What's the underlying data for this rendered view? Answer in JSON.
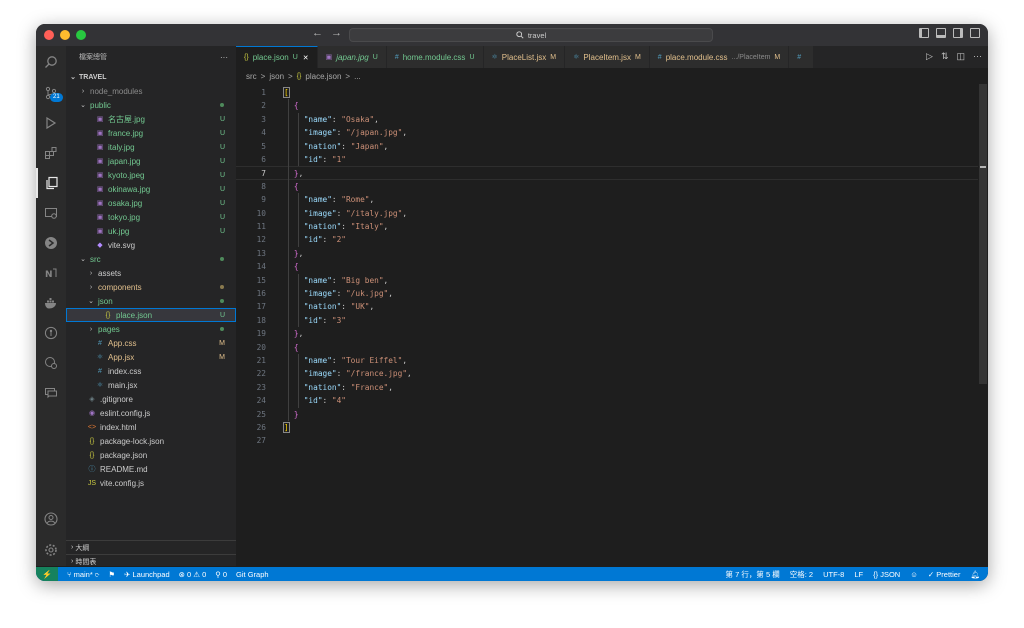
{
  "titlebar": {
    "search_text": "travel",
    "back": "←",
    "forward": "→"
  },
  "activity": {
    "scm_badge": "21"
  },
  "sidebar": {
    "header": "檔案總管",
    "more": "···",
    "root": "TRAVEL",
    "items": [
      {
        "name": "node_modules",
        "type": "folder",
        "open": false,
        "depth": 1,
        "status": "",
        "color": "grey"
      },
      {
        "name": "public",
        "type": "folder",
        "open": true,
        "depth": 1,
        "status": "dot",
        "color": "green"
      },
      {
        "name": "名古屋.jpg",
        "type": "image",
        "depth": 2,
        "status": "U",
        "color": "green"
      },
      {
        "name": "france.jpg",
        "type": "image",
        "depth": 2,
        "status": "U",
        "color": "green"
      },
      {
        "name": "italy.jpg",
        "type": "image",
        "depth": 2,
        "status": "U",
        "color": "green"
      },
      {
        "name": "japan.jpg",
        "type": "image",
        "depth": 2,
        "status": "U",
        "color": "green"
      },
      {
        "name": "kyoto.jpeg",
        "type": "image",
        "depth": 2,
        "status": "U",
        "color": "green"
      },
      {
        "name": "okinawa.jpg",
        "type": "image",
        "depth": 2,
        "status": "U",
        "color": "green"
      },
      {
        "name": "osaka.jpg",
        "type": "image",
        "depth": 2,
        "status": "U",
        "color": "green"
      },
      {
        "name": "tokyo.jpg",
        "type": "image",
        "depth": 2,
        "status": "U",
        "color": "green"
      },
      {
        "name": "uk.jpg",
        "type": "image",
        "depth": 2,
        "status": "U",
        "color": "green"
      },
      {
        "name": "vite.svg",
        "type": "svg",
        "depth": 2,
        "status": "",
        "color": "plain"
      },
      {
        "name": "src",
        "type": "folder",
        "open": true,
        "depth": 1,
        "status": "dot",
        "color": "green"
      },
      {
        "name": "assets",
        "type": "folder",
        "open": false,
        "depth": 2,
        "status": "",
        "color": "plain"
      },
      {
        "name": "components",
        "type": "folder",
        "open": false,
        "depth": 2,
        "status": "dot",
        "color": "orange"
      },
      {
        "name": "json",
        "type": "folder",
        "open": true,
        "depth": 2,
        "status": "dot",
        "color": "green"
      },
      {
        "name": "place.json",
        "type": "json",
        "depth": 3,
        "status": "U",
        "color": "green",
        "selected": true
      },
      {
        "name": "pages",
        "type": "folder",
        "open": false,
        "depth": 2,
        "status": "dot",
        "color": "green"
      },
      {
        "name": "App.css",
        "type": "css",
        "depth": 2,
        "status": "M",
        "color": "orange"
      },
      {
        "name": "App.jsx",
        "type": "jsx",
        "depth": 2,
        "status": "M",
        "color": "orange"
      },
      {
        "name": "index.css",
        "type": "css",
        "depth": 2,
        "status": "",
        "color": "plain"
      },
      {
        "name": "main.jsx",
        "type": "jsx",
        "depth": 2,
        "status": "",
        "color": "plain"
      },
      {
        "name": ".gitignore",
        "type": "git",
        "depth": 1,
        "status": "",
        "color": "plain"
      },
      {
        "name": "eslint.config.js",
        "type": "eslint",
        "depth": 1,
        "status": "",
        "color": "plain"
      },
      {
        "name": "index.html",
        "type": "html",
        "depth": 1,
        "status": "",
        "color": "plain"
      },
      {
        "name": "package-lock.json",
        "type": "json",
        "depth": 1,
        "status": "",
        "color": "plain"
      },
      {
        "name": "package.json",
        "type": "json",
        "depth": 1,
        "status": "",
        "color": "plain"
      },
      {
        "name": "README.md",
        "type": "info",
        "depth": 1,
        "status": "",
        "color": "plain"
      },
      {
        "name": "vite.config.js",
        "type": "js",
        "depth": 1,
        "status": "",
        "color": "plain"
      }
    ],
    "outline_label": "大綱",
    "timeline_label": "時間表"
  },
  "tabs": [
    {
      "icon": "{}",
      "label": "place.json",
      "status": "U",
      "active": true,
      "close": "✕"
    },
    {
      "icon": "▣",
      "label": "japan.jpg",
      "status": "U",
      "italic": true
    },
    {
      "icon": "#",
      "label": "home.module.css",
      "status": "U"
    },
    {
      "icon": "⚛",
      "label": "PlaceList.jsx",
      "status": "M"
    },
    {
      "icon": "⚛",
      "label": "PlaceItem.jsx",
      "status": "M"
    },
    {
      "icon": "#",
      "label": "place.module.css",
      "desc": ".../PlaceItem",
      "status": "M"
    },
    {
      "icon": "#",
      "label": "",
      "status": ""
    }
  ],
  "breadcrumb": {
    "p1": "src",
    "p2": "json",
    "p3": "place.json",
    "p4": "...",
    "sep": ">",
    "json_icon": "{}"
  },
  "code": {
    "current_line": 7,
    "lines": [
      [
        [
          "b1",
          "["
        ]
      ],
      [
        [
          "b2",
          "{"
        ]
      ],
      [
        [
          "k",
          "\"name\""
        ],
        [
          "p",
          ": "
        ],
        [
          "s",
          "\"Osaka\""
        ],
        [
          "p",
          ","
        ]
      ],
      [
        [
          "k",
          "\"image\""
        ],
        [
          "p",
          ": "
        ],
        [
          "s",
          "\"/japan.jpg\""
        ],
        [
          "p",
          ","
        ]
      ],
      [
        [
          "k",
          "\"nation\""
        ],
        [
          "p",
          ": "
        ],
        [
          "s",
          "\"Japan\""
        ],
        [
          "p",
          ","
        ]
      ],
      [
        [
          "k",
          "\"id\""
        ],
        [
          "p",
          ": "
        ],
        [
          "s",
          "\"1\""
        ]
      ],
      [
        [
          "b2",
          "}"
        ],
        [
          "p",
          ","
        ]
      ],
      [
        [
          "b2",
          "{"
        ]
      ],
      [
        [
          "k",
          "\"name\""
        ],
        [
          "p",
          ": "
        ],
        [
          "s",
          "\"Rome\""
        ],
        [
          "p",
          ","
        ]
      ],
      [
        [
          "k",
          "\"image\""
        ],
        [
          "p",
          ": "
        ],
        [
          "s",
          "\"/italy.jpg\""
        ],
        [
          "p",
          ","
        ]
      ],
      [
        [
          "k",
          "\"nation\""
        ],
        [
          "p",
          ": "
        ],
        [
          "s",
          "\"Italy\""
        ],
        [
          "p",
          ","
        ]
      ],
      [
        [
          "k",
          "\"id\""
        ],
        [
          "p",
          ": "
        ],
        [
          "s",
          "\"2\""
        ]
      ],
      [
        [
          "b2",
          "}"
        ],
        [
          "p",
          ","
        ]
      ],
      [
        [
          "b2",
          "{"
        ]
      ],
      [
        [
          "k",
          "\"name\""
        ],
        [
          "p",
          ": "
        ],
        [
          "s",
          "\"Big ben\""
        ],
        [
          "p",
          ","
        ]
      ],
      [
        [
          "k",
          "\"image\""
        ],
        [
          "p",
          ": "
        ],
        [
          "s",
          "\"/uk.jpg\""
        ],
        [
          "p",
          ","
        ]
      ],
      [
        [
          "k",
          "\"nation\""
        ],
        [
          "p",
          ": "
        ],
        [
          "s",
          "\"UK\""
        ],
        [
          "p",
          ","
        ]
      ],
      [
        [
          "k",
          "\"id\""
        ],
        [
          "p",
          ": "
        ],
        [
          "s",
          "\"3\""
        ]
      ],
      [
        [
          "b2",
          "}"
        ],
        [
          "p",
          ","
        ]
      ],
      [
        [
          "b2",
          "{"
        ]
      ],
      [
        [
          "k",
          "\"name\""
        ],
        [
          "p",
          ": "
        ],
        [
          "s",
          "\"Tour Eiffel\""
        ],
        [
          "p",
          ","
        ]
      ],
      [
        [
          "k",
          "\"image\""
        ],
        [
          "p",
          ": "
        ],
        [
          "s",
          "\"/france.jpg\""
        ],
        [
          "p",
          ","
        ]
      ],
      [
        [
          "k",
          "\"nation\""
        ],
        [
          "p",
          ": "
        ],
        [
          "s",
          "\"France\""
        ],
        [
          "p",
          ","
        ]
      ],
      [
        [
          "k",
          "\"id\""
        ],
        [
          "p",
          ": "
        ],
        [
          "s",
          "\"4\""
        ]
      ],
      [
        [
          "b2",
          "}"
        ]
      ],
      [
        [
          "b1",
          "]"
        ]
      ],
      []
    ],
    "indent": [
      0,
      1,
      2,
      2,
      2,
      2,
      1,
      1,
      2,
      2,
      2,
      2,
      1,
      1,
      2,
      2,
      2,
      2,
      1,
      1,
      2,
      2,
      2,
      2,
      1,
      0,
      0
    ]
  },
  "statusbar": {
    "branch": "main*",
    "launchpad": "Launchpad",
    "errors": "0",
    "warnings": "0",
    "ports": "0",
    "git_graph": "Git Graph",
    "position": "第 7 行，第 5 欄",
    "spaces": "空格: 2",
    "encoding": "UTF-8",
    "eol": "LF",
    "language": "JSON",
    "prettier": "Prettier"
  },
  "colors": {
    "accent": "#0078d4",
    "added": "#73c991",
    "modified": "#e2c08d"
  }
}
